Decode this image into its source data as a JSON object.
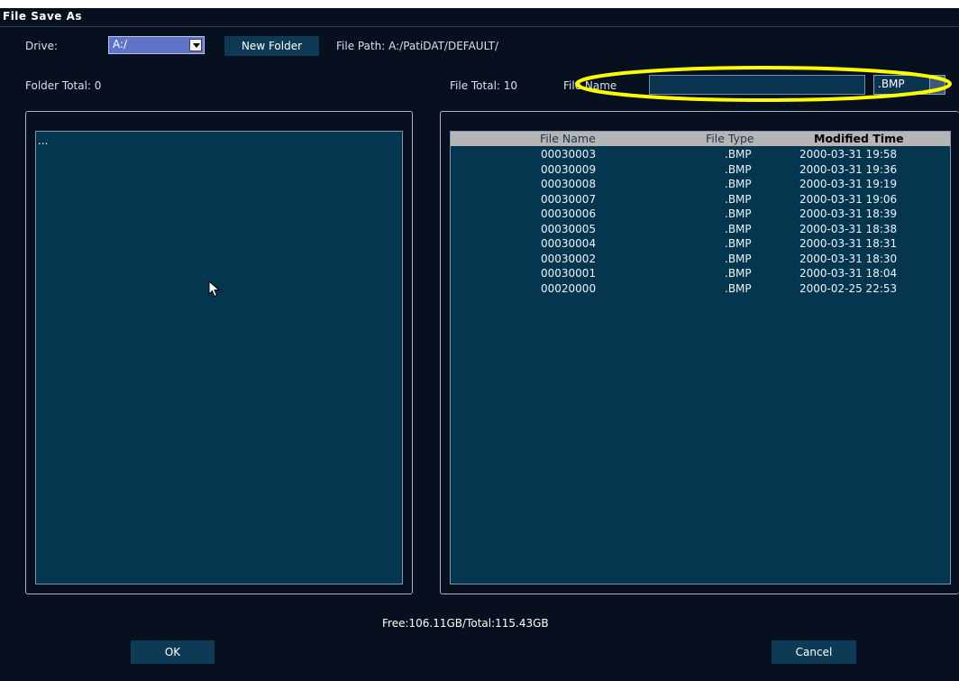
{
  "window": {
    "title": "File Save As"
  },
  "drive": {
    "label": "Drive:",
    "value": "A:/"
  },
  "toolbar": {
    "new_folder_label": "New Folder"
  },
  "path": {
    "text": "File Path: A:/PatiDAT/DEFAULT/"
  },
  "folder": {
    "total_label": "Folder Total: 0",
    "items": [
      "..."
    ]
  },
  "file": {
    "total_label": "File Total: 10",
    "name_label": "File Name",
    "name_value": "",
    "ext_value": ".BMP",
    "columns": {
      "name": "File Name",
      "type": "File Type",
      "time": "Modified Time"
    },
    "rows": [
      {
        "name": "00030003",
        "type": ".BMP",
        "time": "2000-03-31 19:58"
      },
      {
        "name": "00030009",
        "type": ".BMP",
        "time": "2000-03-31 19:36"
      },
      {
        "name": "00030008",
        "type": ".BMP",
        "time": "2000-03-31 19:19"
      },
      {
        "name": "00030007",
        "type": ".BMP",
        "time": "2000-03-31 19:06"
      },
      {
        "name": "00030006",
        "type": ".BMP",
        "time": "2000-03-31 18:39"
      },
      {
        "name": "00030005",
        "type": ".BMP",
        "time": "2000-03-31 18:38"
      },
      {
        "name": "00030004",
        "type": ".BMP",
        "time": "2000-03-31 18:31"
      },
      {
        "name": "00030002",
        "type": ".BMP",
        "time": "2000-03-31 18:30"
      },
      {
        "name": "00030001",
        "type": ".BMP",
        "time": "2000-03-31 18:04"
      },
      {
        "name": "00020000",
        "type": ".BMP",
        "time": "2000-02-25 22:53"
      }
    ]
  },
  "storage": {
    "text": "Free:106.11GB/Total:115.43GB"
  },
  "buttons": {
    "ok": "OK",
    "cancel": "Cancel"
  },
  "colors": {
    "background": "#06101e",
    "list_bg": "#043650",
    "button_bg": "#0f3a56",
    "highlight": "#ffff00",
    "drive_bg": "#5f74c8"
  }
}
